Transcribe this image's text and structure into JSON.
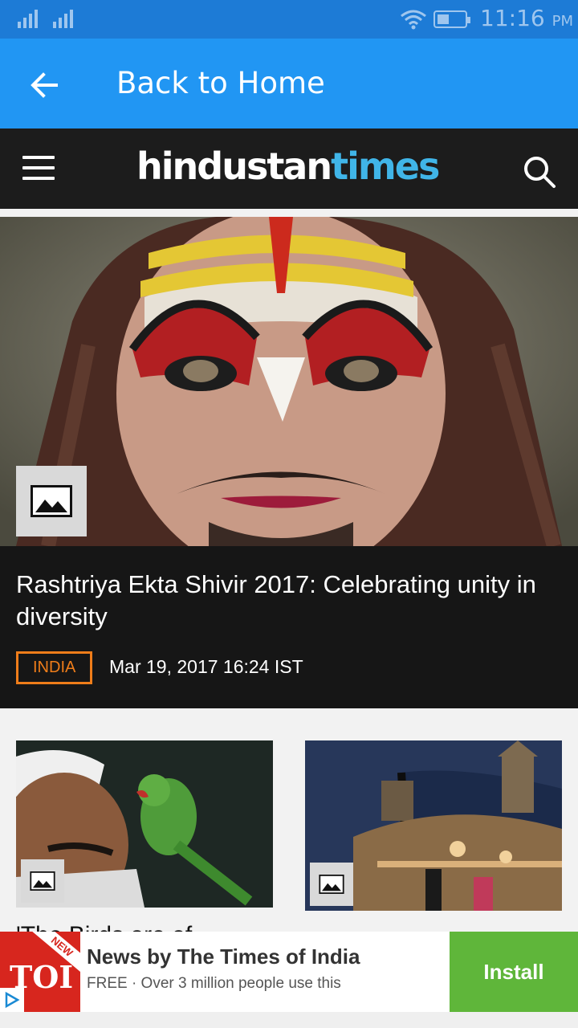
{
  "status_bar": {
    "time": "11:16",
    "ampm": "PM"
  },
  "app_bar": {
    "title": "Back to Home"
  },
  "site": {
    "logo_part1": "hindustan",
    "logo_part2": "times"
  },
  "hero": {
    "title": "Rashtriya Ekta Shivir 2017: Celebrating unity in diversity",
    "tag": "INDIA",
    "date": "Mar 19, 2017 16:24 IST"
  },
  "cards": [
    {
      "partial_title": "'The Birds are of"
    }
  ],
  "ad": {
    "brand": "TOI",
    "ribbon": "NEW",
    "title": "News by The Times of India",
    "subtitle": "FREE · Over 3 million people use this",
    "cta": "Install"
  },
  "colors": {
    "status_bar": "#1d7bd6",
    "app_bar": "#2196f3",
    "header": "#1c1c1c",
    "tag": "#ef7d1a",
    "install": "#5fb63a",
    "logo_accent": "#40b5e8"
  },
  "icons": [
    "back-arrow-icon",
    "menu-icon",
    "search-icon",
    "image-icon",
    "wifi-icon",
    "battery-icon",
    "signal-icon",
    "ad-choices-icon"
  ]
}
